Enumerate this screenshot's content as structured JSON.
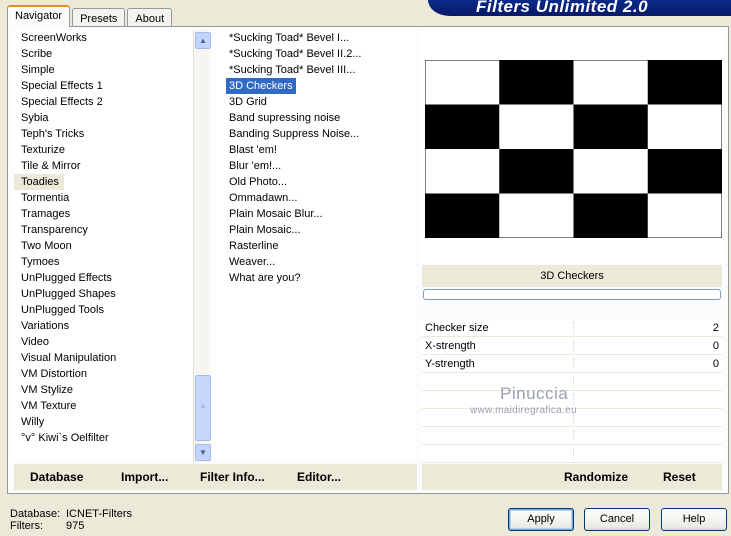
{
  "tabs": [
    {
      "label": "Navigator"
    },
    {
      "label": "Presets"
    },
    {
      "label": "About"
    }
  ],
  "banner": "Filters Unlimited 2.0",
  "categories": [
    "ScreenWorks",
    "Scribe",
    "Simple",
    "Special Effects 1",
    "Special Effects 2",
    "Sybia",
    "Teph's Tricks",
    "Texturize",
    "Tile & Mirror",
    "Toadies",
    "Tormentia",
    "Tramages",
    "Transparency",
    "Two Moon",
    "Tymoes",
    "UnPlugged Effects",
    "UnPlugged Shapes",
    "UnPlugged Tools",
    "Variations",
    "Video",
    "Visual Manipulation",
    "VM Distortion",
    "VM Stylize",
    "VM Texture",
    "Willy",
    "°v° Kiwi`s Oelfilter"
  ],
  "selected_category": "Toadies",
  "filters": [
    "*Sucking Toad*  Bevel I...",
    "*Sucking Toad*  Bevel II.2...",
    "*Sucking Toad*  Bevel III...",
    "3D Checkers",
    "3D Grid",
    "Band supressing noise",
    "Banding Suppress Noise...",
    "Blast 'em!",
    "Blur 'em!...",
    "Old Photo...",
    "Ommadawn...",
    "Plain Mosaic Blur...",
    "Plain Mosaic...",
    "Rasterline",
    "Weaver...",
    "What are you?"
  ],
  "selected_filter": "3D Checkers",
  "left_buttons": {
    "database": "Database",
    "import": "Import...",
    "filter_info": "Filter Info...",
    "editor": "Editor..."
  },
  "filter_name": "3D Checkers",
  "progress": 0,
  "params": [
    {
      "label": "Checker size",
      "value": "2"
    },
    {
      "label": "X-strength",
      "value": "0"
    },
    {
      "label": "Y-strength",
      "value": "0"
    }
  ],
  "watermark": {
    "line1": "Pinuccia",
    "line2": "www.maidiregrafica.eu"
  },
  "right_buttons": {
    "randomize": "Randomize",
    "reset": "Reset"
  },
  "status": {
    "database_label": "Database:",
    "database_value": "ICNET-Filters",
    "filters_label": "Filters:",
    "filters_value": "975"
  },
  "footer_buttons": {
    "apply": "Apply",
    "cancel": "Cancel",
    "help": "Help"
  },
  "colors": {
    "selection": "#316ac5",
    "banner": "#0a2a8a",
    "face": "#ece9d8"
  }
}
